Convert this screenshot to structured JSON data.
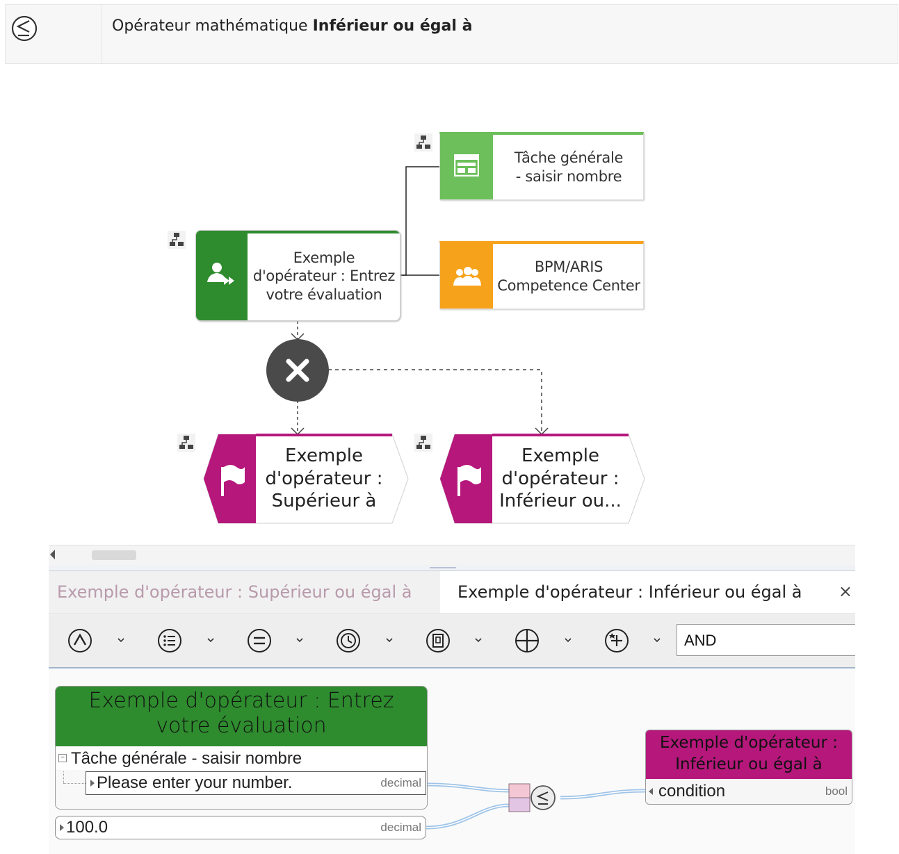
{
  "header": {
    "prefix": "Opérateur mathématique",
    "bold": "Inférieur ou égal à",
    "icon": "less-or-equal-icon"
  },
  "diagram": {
    "function": "Exemple d'opérateur : Entrez votre évaluation",
    "function_line1": "Exemple",
    "function_line2": "d'opérateur : Entrez",
    "function_line3": "votre évaluation",
    "task_line1": "Tâche générale",
    "task_line2": "- saisir nombre",
    "org_line1": "BPM/ARIS",
    "org_line2": "Competence Center",
    "event1_line1": "Exemple",
    "event1_line2": "d'opérateur :",
    "event1_line3": "Supérieur à",
    "event2_line1": "Exemple",
    "event2_line2": "d'opérateur :",
    "event2_line3": "Inférieur ou...",
    "colors": {
      "function": "#2e8b2e",
      "task": "#6cbf5a",
      "org": "#f7a21b",
      "event": "#b5177b",
      "gateway": "#4a4a4a"
    }
  },
  "tabs": {
    "inactive": "Exemple d'opérateur : Supérieur ou égal à",
    "active": "Exemple d'opérateur : Inférieur ou égal à",
    "close": "×"
  },
  "toolbar": {
    "buttons": [
      "logic-operator-icon",
      "list-operator-icon",
      "comparison-operator-icon",
      "time-operator-icon",
      "document-operator-icon",
      "arithmetic-operator-icon",
      "special-operator-icon"
    ],
    "select_value": "AND"
  },
  "mapping": {
    "source_title": "Exemple d'opérateur : Entrez votre évaluation",
    "source_title_line1": "Exemple d'opérateur : Entrez",
    "source_title_line2": "votre évaluation",
    "source_group": "Tâche générale - saisir nombre",
    "source_field": "Please enter your number.",
    "source_field_type": "decimal",
    "constant_value": "100.0",
    "constant_type": "decimal",
    "target_title_line1": "Exemple d'opérateur :",
    "target_title_line2": "Inférieur ou égal à",
    "target_field": "condition",
    "target_field_type": "bool"
  }
}
